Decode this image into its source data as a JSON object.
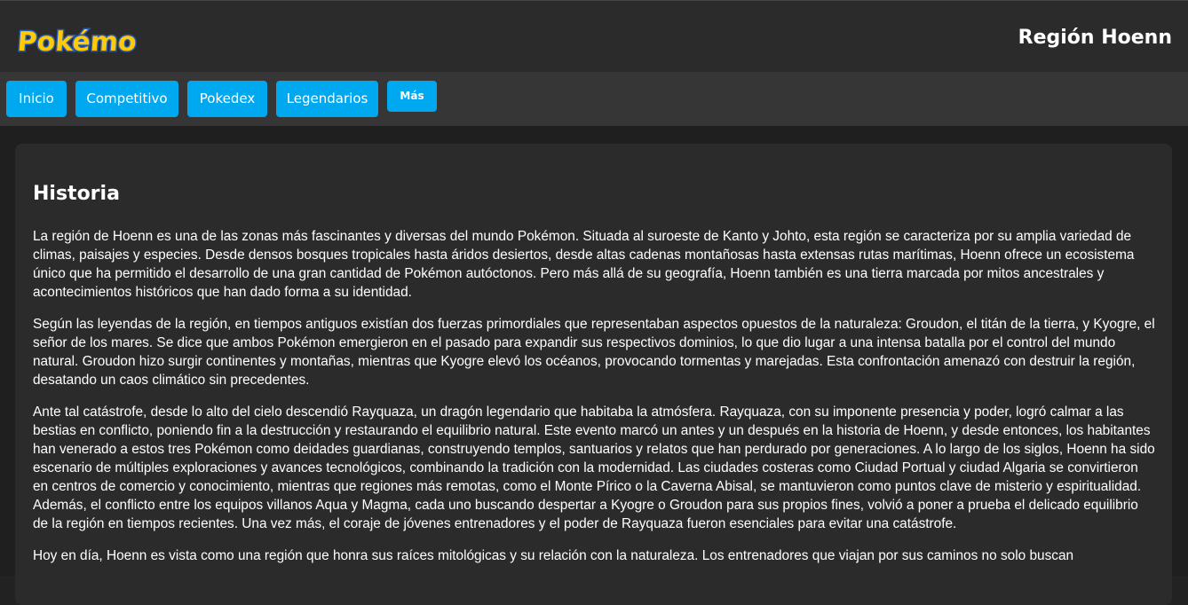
{
  "header": {
    "logo_text": "Pokémon",
    "title": "Región Hoenn"
  },
  "nav": {
    "items": [
      {
        "label": "Inicio"
      },
      {
        "label": "Competitivo"
      },
      {
        "label": "Pokedex"
      },
      {
        "label": "Legendarios"
      },
      {
        "label": "Más"
      }
    ]
  },
  "section": {
    "heading": "Historia",
    "paragraphs": [
      "La región de Hoenn es una de las zonas más fascinantes y diversas del mundo Pokémon. Situada al suroeste de Kanto y Johto, esta región se caracteriza por su amplia variedad de climas, paisajes y especies. Desde densos bosques tropicales hasta áridos desiertos, desde altas cadenas montañosas hasta extensas rutas marítimas, Hoenn ofrece un ecosistema único que ha permitido el desarrollo de una gran cantidad de Pokémon autóctonos. Pero más allá de su geografía, Hoenn también es una tierra marcada por mitos ancestrales y acontecimientos históricos que han dado forma a su identidad.",
      "Según las leyendas de la región, en tiempos antiguos existían dos fuerzas primordiales que representaban aspectos opuestos de la naturaleza: Groudon, el titán de la tierra, y Kyogre, el señor de los mares. Se dice que ambos Pokémon emergieron en el pasado para expandir sus respectivos dominios, lo que dio lugar a una intensa batalla por el control del mundo natural. Groudon hizo surgir continentes y montañas, mientras que Kyogre elevó los océanos, provocando tormentas y marejadas. Esta confrontación amenazó con destruir la región, desatando un caos climático sin precedentes.",
      "Ante tal catástrofe, desde lo alto del cielo descendió Rayquaza, un dragón legendario que habitaba la atmósfera. Rayquaza, con su imponente presencia y poder, logró calmar a las bestias en conflicto, poniendo fin a la destrucción y restaurando el equilibrio natural. Este evento marcó un antes y un después en la historia de Hoenn, y desde entonces, los habitantes han venerado a estos tres Pokémon como deidades guardianas, construyendo templos, santuarios y relatos que han perdurado por generaciones. A lo largo de los siglos, Hoenn ha sido escenario de múltiples exploraciones y avances tecnológicos, combinando la tradición con la modernidad. Las ciudades costeras como Ciudad Portual y ciudad Algaria se convirtieron en centros de comercio y conocimiento, mientras que regiones más remotas, como el Monte Pírico o la Caverna Abisal, se mantuvieron como puntos clave de misterio y espiritualidad. Además, el conflicto entre los equipos villanos Aqua y Magma, cada uno buscando despertar a Kyogre o Groudon para sus propios fines, volvió a poner a prueba el delicado equilibrio de la región en tiempos recientes. Una vez más, el coraje de jóvenes entrenadores y el poder de Rayquaza fueron esenciales para evitar una catástrofe.",
      "Hoy en día, Hoenn es vista como una región que honra sus raíces mitológicas y su relación con la naturaleza. Los entrenadores que viajan por sus caminos no solo buscan"
    ]
  },
  "colors": {
    "accent": "#00a8f0",
    "header_bg": "#2b2b2b",
    "nav_bg": "#363636",
    "card_bg": "#2b2b2b",
    "logo_yellow": "#ffcb05",
    "logo_blue": "#2a5ab8"
  }
}
